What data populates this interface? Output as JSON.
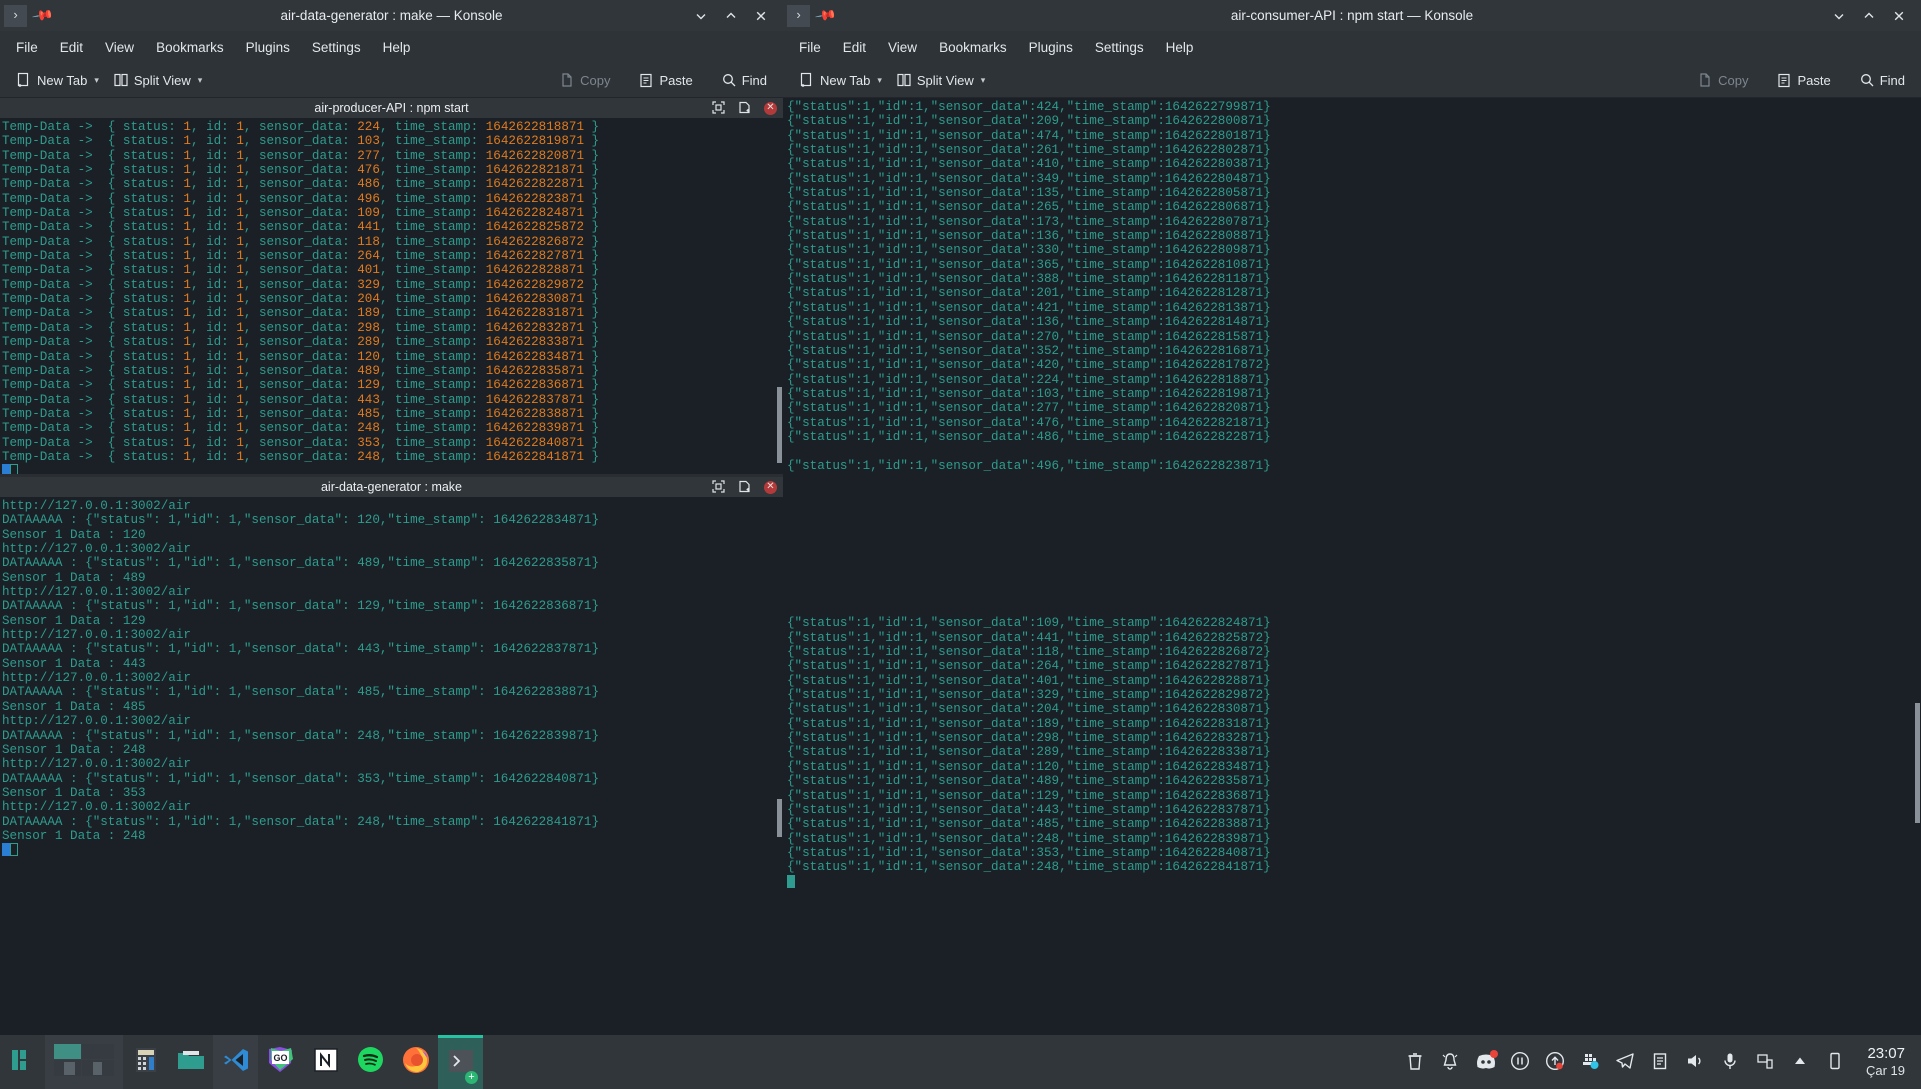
{
  "windows": {
    "left": {
      "title": "air-data-generator : make — Konsole",
      "menu": [
        "File",
        "Edit",
        "View",
        "Bookmarks",
        "Plugins",
        "Settings",
        "Help"
      ],
      "toolbar": {
        "new_tab": "New Tab",
        "split_view": "Split View",
        "copy": "Copy",
        "paste": "Paste",
        "find": "Find"
      },
      "panes": [
        {
          "title": "air-producer-API : npm start",
          "lines": [
            {
              "label": "Temp-Data -> ",
              "pre": " { status: ",
              "status": "1",
              "mid1": ", id: ",
              "id": "1",
              "mid2": ", sensor_data: ",
              "sensor": "224",
              "mid3": ", time_stamp: ",
              "ts": "1642622818871",
              "post": " }"
            },
            {
              "label": "Temp-Data -> ",
              "pre": " { status: ",
              "status": "1",
              "mid1": ", id: ",
              "id": "1",
              "mid2": ", sensor_data: ",
              "sensor": "103",
              "mid3": ", time_stamp: ",
              "ts": "1642622819871",
              "post": " }"
            },
            {
              "label": "Temp-Data -> ",
              "pre": " { status: ",
              "status": "1",
              "mid1": ", id: ",
              "id": "1",
              "mid2": ", sensor_data: ",
              "sensor": "277",
              "mid3": ", time_stamp: ",
              "ts": "1642622820871",
              "post": " }"
            },
            {
              "label": "Temp-Data -> ",
              "pre": " { status: ",
              "status": "1",
              "mid1": ", id: ",
              "id": "1",
              "mid2": ", sensor_data: ",
              "sensor": "476",
              "mid3": ", time_stamp: ",
              "ts": "1642622821871",
              "post": " }"
            },
            {
              "label": "Temp-Data -> ",
              "pre": " { status: ",
              "status": "1",
              "mid1": ", id: ",
              "id": "1",
              "mid2": ", sensor_data: ",
              "sensor": "486",
              "mid3": ", time_stamp: ",
              "ts": "1642622822871",
              "post": " }"
            },
            {
              "label": "Temp-Data -> ",
              "pre": " { status: ",
              "status": "1",
              "mid1": ", id: ",
              "id": "1",
              "mid2": ", sensor_data: ",
              "sensor": "496",
              "mid3": ", time_stamp: ",
              "ts": "1642622823871",
              "post": " }"
            },
            {
              "label": "Temp-Data -> ",
              "pre": " { status: ",
              "status": "1",
              "mid1": ", id: ",
              "id": "1",
              "mid2": ", sensor_data: ",
              "sensor": "109",
              "mid3": ", time_stamp: ",
              "ts": "1642622824871",
              "post": " }"
            },
            {
              "label": "Temp-Data -> ",
              "pre": " { status: ",
              "status": "1",
              "mid1": ", id: ",
              "id": "1",
              "mid2": ", sensor_data: ",
              "sensor": "441",
              "mid3": ", time_stamp: ",
              "ts": "1642622825872",
              "post": " }"
            },
            {
              "label": "Temp-Data -> ",
              "pre": " { status: ",
              "status": "1",
              "mid1": ", id: ",
              "id": "1",
              "mid2": ", sensor_data: ",
              "sensor": "118",
              "mid3": ", time_stamp: ",
              "ts": "1642622826872",
              "post": " }"
            },
            {
              "label": "Temp-Data -> ",
              "pre": " { status: ",
              "status": "1",
              "mid1": ", id: ",
              "id": "1",
              "mid2": ", sensor_data: ",
              "sensor": "264",
              "mid3": ", time_stamp: ",
              "ts": "1642622827871",
              "post": " }"
            },
            {
              "label": "Temp-Data -> ",
              "pre": " { status: ",
              "status": "1",
              "mid1": ", id: ",
              "id": "1",
              "mid2": ", sensor_data: ",
              "sensor": "401",
              "mid3": ", time_stamp: ",
              "ts": "1642622828871",
              "post": " }"
            },
            {
              "label": "Temp-Data -> ",
              "pre": " { status: ",
              "status": "1",
              "mid1": ", id: ",
              "id": "1",
              "mid2": ", sensor_data: ",
              "sensor": "329",
              "mid3": ", time_stamp: ",
              "ts": "1642622829872",
              "post": " }"
            },
            {
              "label": "Temp-Data -> ",
              "pre": " { status: ",
              "status": "1",
              "mid1": ", id: ",
              "id": "1",
              "mid2": ", sensor_data: ",
              "sensor": "204",
              "mid3": ", time_stamp: ",
              "ts": "1642622830871",
              "post": " }"
            },
            {
              "label": "Temp-Data -> ",
              "pre": " { status: ",
              "status": "1",
              "mid1": ", id: ",
              "id": "1",
              "mid2": ", sensor_data: ",
              "sensor": "189",
              "mid3": ", time_stamp: ",
              "ts": "1642622831871",
              "post": " }"
            },
            {
              "label": "Temp-Data -> ",
              "pre": " { status: ",
              "status": "1",
              "mid1": ", id: ",
              "id": "1",
              "mid2": ", sensor_data: ",
              "sensor": "298",
              "mid3": ", time_stamp: ",
              "ts": "1642622832871",
              "post": " }"
            },
            {
              "label": "Temp-Data -> ",
              "pre": " { status: ",
              "status": "1",
              "mid1": ", id: ",
              "id": "1",
              "mid2": ", sensor_data: ",
              "sensor": "289",
              "mid3": ", time_stamp: ",
              "ts": "1642622833871",
              "post": " }"
            },
            {
              "label": "Temp-Data -> ",
              "pre": " { status: ",
              "status": "1",
              "mid1": ", id: ",
              "id": "1",
              "mid2": ", sensor_data: ",
              "sensor": "120",
              "mid3": ", time_stamp: ",
              "ts": "1642622834871",
              "post": " }"
            },
            {
              "label": "Temp-Data -> ",
              "pre": " { status: ",
              "status": "1",
              "mid1": ", id: ",
              "id": "1",
              "mid2": ", sensor_data: ",
              "sensor": "489",
              "mid3": ", time_stamp: ",
              "ts": "1642622835871",
              "post": " }"
            },
            {
              "label": "Temp-Data -> ",
              "pre": " { status: ",
              "status": "1",
              "mid1": ", id: ",
              "id": "1",
              "mid2": ", sensor_data: ",
              "sensor": "129",
              "mid3": ", time_stamp: ",
              "ts": "1642622836871",
              "post": " }"
            },
            {
              "label": "Temp-Data -> ",
              "pre": " { status: ",
              "status": "1",
              "mid1": ", id: ",
              "id": "1",
              "mid2": ", sensor_data: ",
              "sensor": "443",
              "mid3": ", time_stamp: ",
              "ts": "1642622837871",
              "post": " }"
            },
            {
              "label": "Temp-Data -> ",
              "pre": " { status: ",
              "status": "1",
              "mid1": ", id: ",
              "id": "1",
              "mid2": ", sensor_data: ",
              "sensor": "485",
              "mid3": ", time_stamp: ",
              "ts": "1642622838871",
              "post": " }"
            },
            {
              "label": "Temp-Data -> ",
              "pre": " { status: ",
              "status": "1",
              "mid1": ", id: ",
              "id": "1",
              "mid2": ", sensor_data: ",
              "sensor": "248",
              "mid3": ", time_stamp: ",
              "ts": "1642622839871",
              "post": " }"
            },
            {
              "label": "Temp-Data -> ",
              "pre": " { status: ",
              "status": "1",
              "mid1": ", id: ",
              "id": "1",
              "mid2": ", sensor_data: ",
              "sensor": "353",
              "mid3": ", time_stamp: ",
              "ts": "1642622840871",
              "post": " }"
            },
            {
              "label": "Temp-Data -> ",
              "pre": " { status: ",
              "status": "1",
              "mid1": ", id: ",
              "id": "1",
              "mid2": ", sensor_data: ",
              "sensor": "248",
              "mid3": ", time_stamp: ",
              "ts": "1642622841871",
              "post": " }"
            }
          ]
        },
        {
          "title": "air-data-generator : make",
          "lines": [
            "http://127.0.0.1:3002/air",
            "DATAAAAA : {\"status\": 1,\"id\": 1,\"sensor_data\": 120,\"time_stamp\": 1642622834871}",
            "Sensor 1 Data : 120",
            "http://127.0.0.1:3002/air",
            "DATAAAAA : {\"status\": 1,\"id\": 1,\"sensor_data\": 489,\"time_stamp\": 1642622835871}",
            "Sensor 1 Data : 489",
            "http://127.0.0.1:3002/air",
            "DATAAAAA : {\"status\": 1,\"id\": 1,\"sensor_data\": 129,\"time_stamp\": 1642622836871}",
            "Sensor 1 Data : 129",
            "http://127.0.0.1:3002/air",
            "DATAAAAA : {\"status\": 1,\"id\": 1,\"sensor_data\": 443,\"time_stamp\": 1642622837871}",
            "Sensor 1 Data : 443",
            "http://127.0.0.1:3002/air",
            "DATAAAAA : {\"status\": 1,\"id\": 1,\"sensor_data\": 485,\"time_stamp\": 1642622838871}",
            "Sensor 1 Data : 485",
            "http://127.0.0.1:3002/air",
            "DATAAAAA : {\"status\": 1,\"id\": 1,\"sensor_data\": 248,\"time_stamp\": 1642622839871}",
            "Sensor 1 Data : 248",
            "http://127.0.0.1:3002/air",
            "DATAAAAA : {\"status\": 1,\"id\": 1,\"sensor_data\": 353,\"time_stamp\": 1642622840871}",
            "Sensor 1 Data : 353",
            "http://127.0.0.1:3002/air",
            "DATAAAAA : {\"status\": 1,\"id\": 1,\"sensor_data\": 248,\"time_stamp\": 1642622841871}",
            "Sensor 1 Data : 248"
          ]
        }
      ]
    },
    "right": {
      "title": "air-consumer-API : npm start — Konsole",
      "menu": [
        "File",
        "Edit",
        "View",
        "Bookmarks",
        "Plugins",
        "Settings",
        "Help"
      ],
      "toolbar": {
        "new_tab": "New Tab",
        "split_view": "Split View",
        "copy": "Copy",
        "paste": "Paste",
        "find": "Find"
      },
      "block_top": [
        "{\"status\":1,\"id\":1,\"sensor_data\":424,\"time_stamp\":1642622799871}",
        "{\"status\":1,\"id\":1,\"sensor_data\":209,\"time_stamp\":1642622800871}",
        "{\"status\":1,\"id\":1,\"sensor_data\":474,\"time_stamp\":1642622801871}",
        "{\"status\":1,\"id\":1,\"sensor_data\":261,\"time_stamp\":1642622802871}",
        "{\"status\":1,\"id\":1,\"sensor_data\":410,\"time_stamp\":1642622803871}",
        "{\"status\":1,\"id\":1,\"sensor_data\":349,\"time_stamp\":1642622804871}",
        "{\"status\":1,\"id\":1,\"sensor_data\":135,\"time_stamp\":1642622805871}",
        "{\"status\":1,\"id\":1,\"sensor_data\":265,\"time_stamp\":1642622806871}",
        "{\"status\":1,\"id\":1,\"sensor_data\":173,\"time_stamp\":1642622807871}",
        "{\"status\":1,\"id\":1,\"sensor_data\":136,\"time_stamp\":1642622808871}",
        "{\"status\":1,\"id\":1,\"sensor_data\":330,\"time_stamp\":1642622809871}",
        "{\"status\":1,\"id\":1,\"sensor_data\":365,\"time_stamp\":1642622810871}",
        "{\"status\":1,\"id\":1,\"sensor_data\":388,\"time_stamp\":1642622811871}",
        "{\"status\":1,\"id\":1,\"sensor_data\":201,\"time_stamp\":1642622812871}",
        "{\"status\":1,\"id\":1,\"sensor_data\":421,\"time_stamp\":1642622813871}",
        "{\"status\":1,\"id\":1,\"sensor_data\":136,\"time_stamp\":1642622814871}",
        "{\"status\":1,\"id\":1,\"sensor_data\":270,\"time_stamp\":1642622815871}",
        "{\"status\":1,\"id\":1,\"sensor_data\":352,\"time_stamp\":1642622816871}",
        "{\"status\":1,\"id\":1,\"sensor_data\":420,\"time_stamp\":1642622817872}",
        "{\"status\":1,\"id\":1,\"sensor_data\":224,\"time_stamp\":1642622818871}",
        "{\"status\":1,\"id\":1,\"sensor_data\":103,\"time_stamp\":1642622819871}",
        "{\"status\":1,\"id\":1,\"sensor_data\":277,\"time_stamp\":1642622820871}",
        "{\"status\":1,\"id\":1,\"sensor_data\":476,\"time_stamp\":1642622821871}",
        "{\"status\":1,\"id\":1,\"sensor_data\":486,\"time_stamp\":1642622822871}"
      ],
      "block_mid": [
        "{\"status\":1,\"id\":1,\"sensor_data\":496,\"time_stamp\":1642622823871}"
      ],
      "block_bottom": [
        "{\"status\":1,\"id\":1,\"sensor_data\":109,\"time_stamp\":1642622824871}",
        "{\"status\":1,\"id\":1,\"sensor_data\":441,\"time_stamp\":1642622825872}",
        "{\"status\":1,\"id\":1,\"sensor_data\":118,\"time_stamp\":1642622826872}",
        "{\"status\":1,\"id\":1,\"sensor_data\":264,\"time_stamp\":1642622827871}",
        "{\"status\":1,\"id\":1,\"sensor_data\":401,\"time_stamp\":1642622828871}",
        "{\"status\":1,\"id\":1,\"sensor_data\":329,\"time_stamp\":1642622829872}",
        "{\"status\":1,\"id\":1,\"sensor_data\":204,\"time_stamp\":1642622830871}",
        "{\"status\":1,\"id\":1,\"sensor_data\":189,\"time_stamp\":1642622831871}",
        "{\"status\":1,\"id\":1,\"sensor_data\":298,\"time_stamp\":1642622832871}",
        "{\"status\":1,\"id\":1,\"sensor_data\":289,\"time_stamp\":1642622833871}",
        "{\"status\":1,\"id\":1,\"sensor_data\":120,\"time_stamp\":1642622834871}",
        "{\"status\":1,\"id\":1,\"sensor_data\":489,\"time_stamp\":1642622835871}",
        "{\"status\":1,\"id\":1,\"sensor_data\":129,\"time_stamp\":1642622836871}",
        "{\"status\":1,\"id\":1,\"sensor_data\":443,\"time_stamp\":1642622837871}",
        "{\"status\":1,\"id\":1,\"sensor_data\":485,\"time_stamp\":1642622838871}",
        "{\"status\":1,\"id\":1,\"sensor_data\":248,\"time_stamp\":1642622839871}",
        "{\"status\":1,\"id\":1,\"sensor_data\":353,\"time_stamp\":1642622840871}",
        "{\"status\":1,\"id\":1,\"sensor_data\":248,\"time_stamp\":1642622841871}"
      ]
    }
  },
  "taskbar": {
    "apps": [
      {
        "name": "manjaro-menu-icon"
      },
      {
        "name": "window-tiling-icon"
      },
      {
        "name": "calculator-icon"
      },
      {
        "name": "file-manager-icon"
      },
      {
        "name": "vscode-icon"
      },
      {
        "name": "goland-icon"
      },
      {
        "name": "notion-icon"
      },
      {
        "name": "spotify-icon"
      },
      {
        "name": "firefox-icon"
      },
      {
        "name": "konsole-icon"
      }
    ],
    "tray": [
      {
        "name": "trash-icon"
      },
      {
        "name": "notifications-bell-icon"
      },
      {
        "name": "discord-icon"
      },
      {
        "name": "media-pause-icon"
      },
      {
        "name": "updates-icon"
      },
      {
        "name": "docker-icon"
      },
      {
        "name": "telegram-icon"
      },
      {
        "name": "clipboard-icon"
      },
      {
        "name": "volume-icon"
      },
      {
        "name": "microphone-icon"
      },
      {
        "name": "network-icon"
      },
      {
        "name": "show-hidden-icon"
      },
      {
        "name": "display-icon"
      }
    ],
    "clock": {
      "time": "23:07",
      "date": "Çar 19"
    }
  },
  "colors": {
    "terminal_bg": "#1b2026",
    "teal": "#2e9c8e",
    "orange": "#e07b1e",
    "titlebar": "#31363b",
    "accent": "#27c2a2"
  }
}
